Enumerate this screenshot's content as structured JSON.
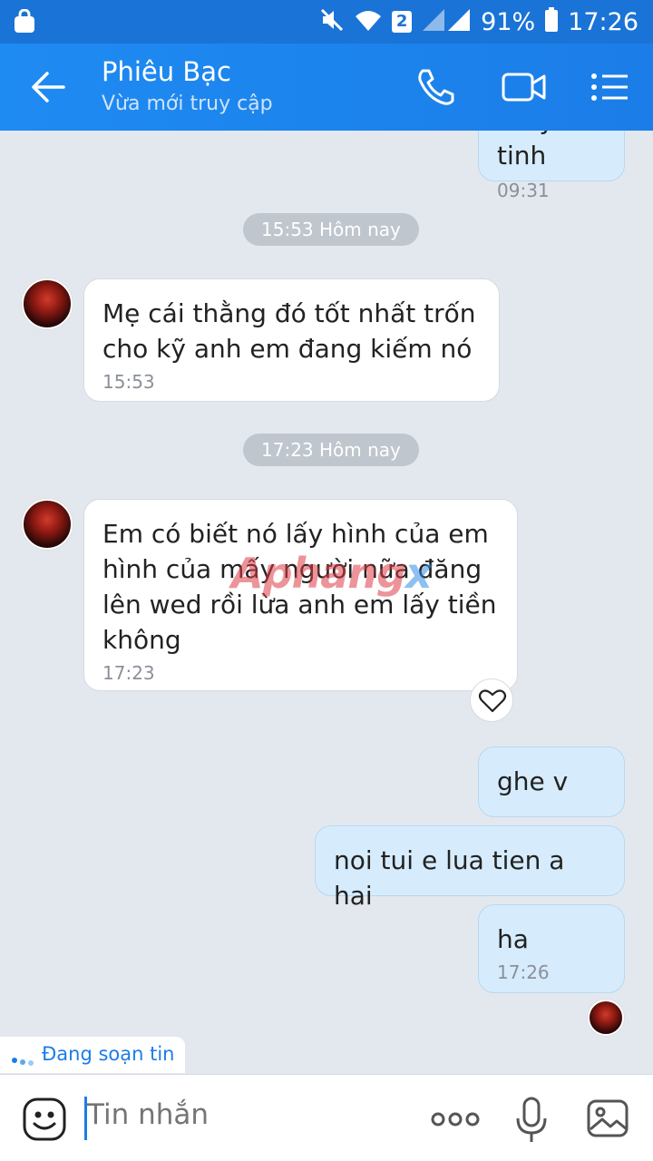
{
  "status_bar": {
    "battery": "91%",
    "time": "17:26",
    "sim": "2",
    "icons": [
      "bag-icon",
      "mute-icon",
      "wifi-icon",
      "signal-icon",
      "battery-icon"
    ]
  },
  "header": {
    "contact_name": "Phiêu Bạc",
    "status": "Vừa mới truy cập",
    "icons": [
      "back-arrow-icon",
      "phone-icon",
      "video-call-icon",
      "menu-list-icon"
    ]
  },
  "chat": {
    "top_partial": {
      "text": "thủy tinh",
      "time": "09:31"
    },
    "pill_1": "15:53 Hôm nay",
    "msg_1": {
      "line1": "Mẹ cái thằng đó tốt nhất trốn",
      "line2": "cho kỹ anh em đang kiếm nó",
      "time": "15:53"
    },
    "pill_2": "17:23 Hôm nay",
    "msg_2": {
      "line1": "Em có biết nó lấy hình của em",
      "line2": "hình của mấy người nữa đăng",
      "line3": "lên wed rồi lừa anh em lấy tiền",
      "line4": "không",
      "time": "17:23"
    },
    "watermark": "Aphang",
    "watermark_x": "x",
    "out_1": "ghe v",
    "out_2": "noi tui e lua tien a hai",
    "out_3": {
      "text": "ha",
      "time": "17:26"
    },
    "typing": "Đang soạn tin"
  },
  "input": {
    "placeholder": "Tin nhắn",
    "icons": [
      "emoji-icon",
      "more-icon",
      "mic-icon",
      "image-icon"
    ]
  },
  "colors": {
    "header": "#1b7de8",
    "status_bar": "#1a73d6",
    "incoming_bubble": "#ffffff",
    "outgoing_bubble": "#d6ecfd",
    "chat_background": "#e3e8ef"
  }
}
